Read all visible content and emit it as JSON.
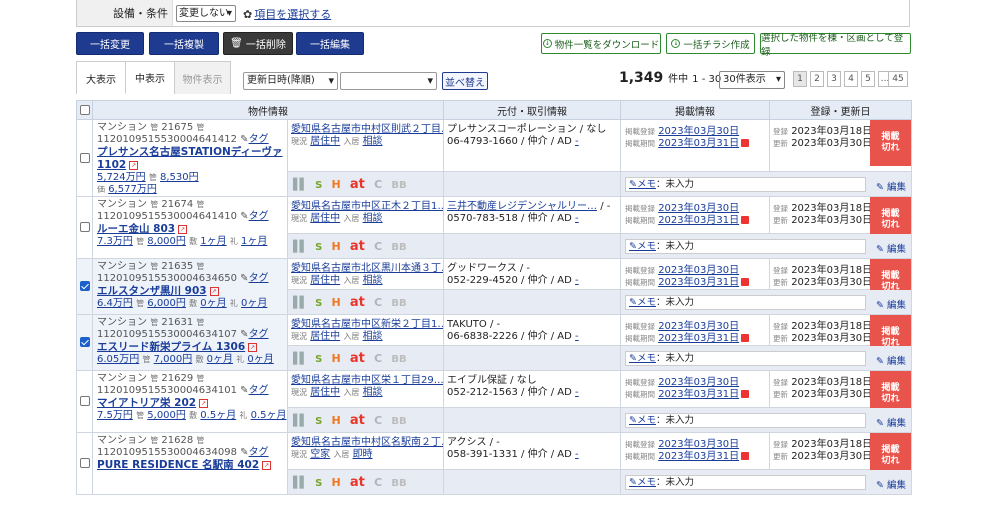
{
  "filter": {
    "label": "設備・条件",
    "select_value": "変更しない",
    "link": "項目を選択する"
  },
  "toolbar": {
    "bulk_change": "一括変更",
    "bulk_copy": "一括複製",
    "bulk_delete": "一括削除",
    "bulk_edit": "一括編集",
    "download": "物件一覧をダウンロード",
    "flyer": "一括チラシ作成",
    "register": "選択した物件を棟・区画として登録"
  },
  "view_tabs": [
    "大表示",
    "中表示",
    "物件表示"
  ],
  "sort": {
    "order": "更新日時(降順)",
    "field2": "",
    "field3": "",
    "button": "並べ替え"
  },
  "results": {
    "total": "1,349",
    "unit": "件中",
    "range": "1 - 30",
    "per_page": "30件表示",
    "pages": [
      "1",
      "2",
      "3",
      "4",
      "5",
      "...",
      "45"
    ]
  },
  "columns": {
    "property": "物件情報",
    "source": "元付・取引情報",
    "listing": "掲載情報",
    "dates": "登録・更新日"
  },
  "labels": {
    "status": "現況",
    "move_in": "入居",
    "listing_reg": "掲載登録",
    "listing_period": "掲載期間",
    "registered": "登録",
    "updated": "更新",
    "tag": "タグ",
    "memo": "メモ",
    "memo_value": "未入力",
    "edit": "編集",
    "expired": "掲載\n切れ",
    "icons": [
      "S",
      "H",
      "at",
      "C",
      "BB"
    ]
  },
  "rows": [
    {
      "checked": false,
      "type": "マンション",
      "num": "21675",
      "id": "112010951553000464141 2",
      "idfull": "1120109515530004641412",
      "name": "プレサンス名古屋STATIONディーヴァ 1102",
      "name1": "プレサンス名古屋STATIONディーヴァ",
      "name2": "1102",
      "price": "5,724万円",
      "m1": "8,530円",
      "m2": "6,577万円",
      "address": "愛知県名古屋市中村区則武２丁目…",
      "status": "居住中",
      "movein": "相談",
      "company": "プレサンスコーポレーション / なし",
      "phone": "06-4793-1660 / 仲介 / AD",
      "dash": "-",
      "list_reg": "2023年03月30日",
      "list_period": "2023年03月31日",
      "reg": "2023年03月18日",
      "upd": "2023年03月30日"
    },
    {
      "checked": false,
      "type": "マンション",
      "num": "21674",
      "idfull": "1120109515530004641410",
      "name1": "ルーエ金山 803",
      "name2": "",
      "price": "7.3万円",
      "m1": "8,000円",
      "m2": "1ヶ月",
      "m3": "1ヶ月",
      "address": "愛知県名古屋市中区正木２丁目1…",
      "status": "居住中",
      "movein": "相談",
      "company": "三井不動産レジデンシャルリー…",
      "company_suffix": "/ -",
      "phone": "0570-783-518 / 仲介 / AD",
      "dash": "-",
      "list_reg": "2023年03月30日",
      "list_period": "2023年03月31日",
      "reg": "2023年03月18日",
      "upd": "2023年03月30日"
    },
    {
      "checked": true,
      "type": "マンション",
      "num": "21635",
      "idfull": "1120109515530004634650",
      "name1": "エルスタンザ黒川 903",
      "name2": "",
      "price": "6.4万円",
      "m1": "6,000円",
      "m2": "0ヶ月",
      "m3": "0ヶ月",
      "address": "愛知県名古屋市北区黒川本通３丁…",
      "status": "居住中",
      "movein": "相談",
      "company": "グッドワークス / -",
      "phone": "052-229-4520 / 仲介 / AD",
      "dash": "-",
      "list_reg": "2023年03月30日",
      "list_period": "2023年03月31日",
      "reg": "2023年03月18日",
      "upd": "2023年03月30日"
    },
    {
      "checked": true,
      "type": "マンション",
      "num": "21631",
      "idfull": "1120109515530004634107",
      "name1": "エスリード新栄プライム 1306",
      "name2": "",
      "price": "6.05万円",
      "m1": "7,000円",
      "m2": "0ヶ月",
      "m3": "0ヶ月",
      "address": "愛知県名古屋市中区新栄２丁目1…",
      "status": "居住中",
      "movein": "相談",
      "company": "TAKUTO / -",
      "phone": "06-6838-2226 / 仲介 / AD",
      "dash": "-",
      "list_reg": "2023年03月30日",
      "list_period": "2023年03月31日",
      "reg": "2023年03月18日",
      "upd": "2023年03月30日"
    },
    {
      "checked": false,
      "type": "マンション",
      "num": "21629",
      "idfull": "1120109515530004634101",
      "name1": "マイアトリア栄 202",
      "name2": "",
      "price": "7.5万円",
      "m1": "5,000円",
      "m2": "0.5ヶ月",
      "m3": "0.5ヶ月",
      "address": "愛知県名古屋市中区栄１丁目29…",
      "status": "居住中",
      "movein": "相談",
      "company": "エイブル保証 / なし",
      "phone": "052-212-1563 / 仲介 / AD",
      "dash": "-",
      "list_reg": "2023年03月30日",
      "list_period": "2023年03月31日",
      "reg": "2023年03月18日",
      "upd": "2023年03月30日"
    },
    {
      "checked": false,
      "type": "マンション",
      "num": "21628",
      "idfull": "1120109515530004634098",
      "name1": "PURE RESIDENCE 名駅南 402",
      "name2": "",
      "price": "",
      "address": "愛知県名古屋市中村区名駅南２丁…",
      "status": "空家",
      "movein": "即時",
      "company": "アクシス / -",
      "phone": "058-391-1331 / 仲介 / AD",
      "dash": "-",
      "list_reg": "2023年03月30日",
      "list_period": "2023年03月31日",
      "reg": "2023年03月18日",
      "upd": "2023年03月30日"
    }
  ]
}
